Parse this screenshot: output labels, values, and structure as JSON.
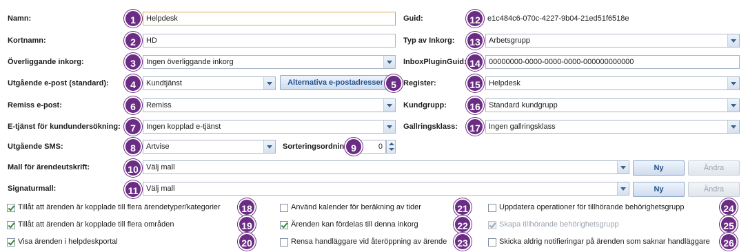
{
  "form": {
    "name_label": "Namn:",
    "name_value": "Helpdesk",
    "short_label": "Kortnamn:",
    "short_value": "HD",
    "parent_label": "Överliggande inkorg:",
    "parent_value": "Ingen överliggande inkorg",
    "outgoing_label": "Utgående e-post (standard):",
    "outgoing_value": "Kundtjänst",
    "alt_email_button": "Alternativa e-postadresser",
    "referral_label": "Remiss e-post:",
    "referral_value": "Remiss",
    "survey_label": "E-tjänst för kundundersökning:",
    "survey_value": "Ingen kopplad e-tjänst",
    "sms_label": "Utgående SMS:",
    "sms_value": "Artvise",
    "sort_label": "Sorteringsordning:",
    "sort_value": "0",
    "print_label": "Mall för ärendeutskrift:",
    "print_value": "Välj mall",
    "sig_label": "Signaturmall:",
    "sig_value": "Välj mall",
    "new_button": "Ny",
    "edit_button": "Ändra",
    "guid_label": "Guid:",
    "guid_value": "e1c484c6-070c-4227-9b04-21ed51f6518e",
    "type_label": "Typ av Inkorg:",
    "type_value": "Arbetsgrupp",
    "plugin_label": "InboxPluginGuid:",
    "plugin_value": "00000000-0000-0000-0000-000000000000",
    "register_label": "Register:",
    "register_value": "Helpdesk",
    "custgroup_label": "Kundgrupp:",
    "custgroup_value": "Standard kundgrupp",
    "retention_label": "Gallringsklass:",
    "retention_value": "Ingen gallringsklass"
  },
  "checkboxes": [
    {
      "label": "Tillåt att ärenden är kopplade till flera ärendetyper/kategorier",
      "checked": true,
      "badge": "18"
    },
    {
      "label": "Tillåt att ärenden är kopplade till flera områden",
      "checked": true,
      "badge": "19"
    },
    {
      "label": "Visa ärenden i helpdeskportal",
      "checked": true,
      "badge": "20"
    },
    {
      "label": "Använd kalender för beräkning av tider",
      "checked": false,
      "badge": "21"
    },
    {
      "label": "Ärenden kan fördelas till denna inkorg",
      "checked": true,
      "badge": "22"
    },
    {
      "label": "Rensa handläggare vid återöppning av ärende",
      "checked": false,
      "badge": "23"
    },
    {
      "label": "Uppdatera operationer för tillhörande behörighetsgrupp",
      "checked": false,
      "badge": "24"
    },
    {
      "label": "Skapa tillhörande behörighetsgrupp",
      "checked": true,
      "disabled": true,
      "badge": "25"
    },
    {
      "label": "Skicka aldrig notifieringar på ärenden som saknar handläggare",
      "checked": false,
      "badge": "26"
    }
  ],
  "badges": [
    "1",
    "2",
    "3",
    "4",
    "5",
    "6",
    "7",
    "8",
    "9",
    "10",
    "11",
    "12",
    "13",
    "14",
    "15",
    "16",
    "17"
  ],
  "colors": {
    "badge": "#6b2c84",
    "field_border": "#aab7c8",
    "focus_border": "#e0a24a"
  }
}
